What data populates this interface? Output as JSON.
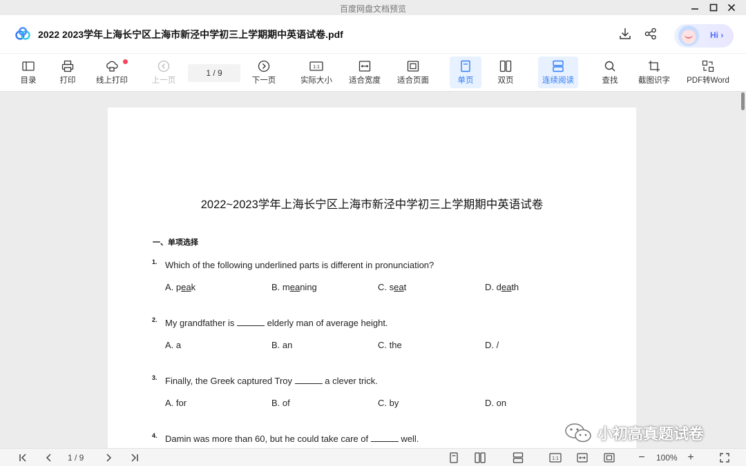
{
  "window": {
    "title": "百度网盘文档预览"
  },
  "document": {
    "file_name": "2022  2023学年上海长宁区上海市新泾中学初三上学期期中英语试卷.pdf",
    "assistant_label": "Hi",
    "assistant_arrow": "›"
  },
  "toolbar": {
    "toc": "目录",
    "print": "打印",
    "online_print": "线上打印",
    "prev_page": "上一页",
    "page_indicator": "1  /  9",
    "next_page": "下一页",
    "actual_size": "实际大小",
    "fit_width": "适合宽度",
    "fit_page": "适合页面",
    "single_page": "单页",
    "double_page": "双页",
    "continuous": "连续阅读",
    "find": "查找",
    "ocr": "截图识字",
    "pdf_to_word": "PDF转Word",
    "actual_size_glyph": "1:1"
  },
  "page": {
    "title": "2022~2023学年上海长宁区上海市新泾中学初三上学期期中英语试卷",
    "section": "一、单项选择",
    "questions": [
      {
        "num": "1.",
        "text": "Which of the following underlined parts is different in pronunciation?",
        "options": [
          {
            "pre": "A. p",
            "ul": "ea",
            "post": "k"
          },
          {
            "pre": "B. m",
            "ul": "ea",
            "post": "ning"
          },
          {
            "pre": "C. s",
            "ul": "ea",
            "post": "t"
          },
          {
            "pre": "D. d",
            "ul": "ea",
            "post": "th"
          }
        ]
      },
      {
        "num": "2.",
        "pre": "My grandfather is ",
        "post": " elderly man of average height.",
        "options": [
          "A. a",
          "B. an",
          "C. the",
          "D. /"
        ]
      },
      {
        "num": "3.",
        "pre": "Finally, the Greek captured Troy ",
        "post": " a clever trick.",
        "options": [
          "A. for",
          "B. of",
          "C. by",
          "D. on"
        ]
      },
      {
        "num": "4.",
        "pre": "Damin was more than 60, but he could take care of ",
        "post": " well."
      }
    ]
  },
  "watermark": {
    "text": "小初高真题试卷"
  },
  "statusbar": {
    "page_indicator": "1  / 9",
    "zoom": "100%",
    "actual_size_glyph": "1:1",
    "zoom_out": "−",
    "zoom_in": "+"
  }
}
